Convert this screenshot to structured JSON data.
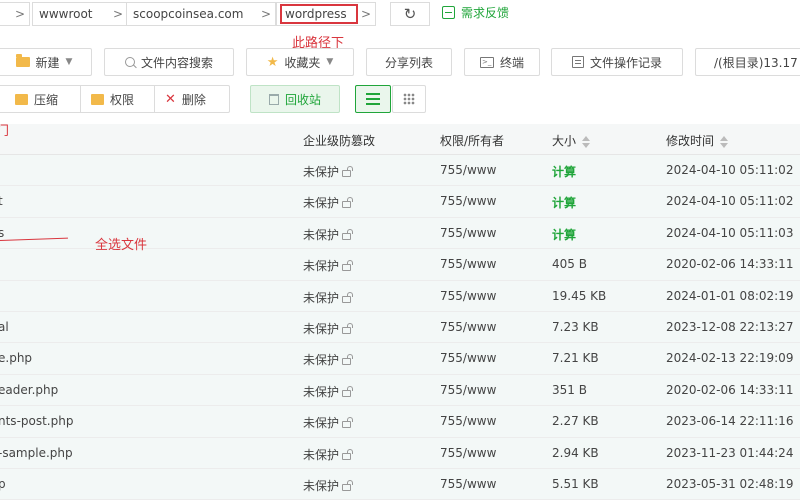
{
  "breadcrumb": {
    "items": [
      "wwwroot",
      "scoopcoinsea.com",
      "wordpress"
    ],
    "separator": ">",
    "feedback_label": "需求反馈"
  },
  "annotations": {
    "path_note": "此路径下",
    "select_all_note": "全选文件",
    "left_cut_note": "门"
  },
  "toolbar": {
    "new_label": "新建",
    "content_search_label": "文件内容搜索",
    "favorites_label": "收藏夹",
    "share_list_label": "分享列表",
    "terminal_label": "终端",
    "file_log_label": "文件操作记录",
    "root_path_label": "/(根目录)13.17",
    "compress_label": "压缩",
    "permission_label": "权限",
    "delete_label": "删除",
    "recycle_label": "回收站"
  },
  "table": {
    "headers": {
      "protection": "企业级防篡改",
      "perm_owner": "权限/所有者",
      "size": "大小",
      "mtime": "修改时间"
    },
    "rows": [
      {
        "name": "",
        "protection": "未保护",
        "perm": "755/www",
        "size": "计算",
        "mtime": "2024-04-10 05:11:02"
      },
      {
        "name": "t",
        "protection": "未保护",
        "perm": "755/www",
        "size": "计算",
        "mtime": "2024-04-10 05:11:02"
      },
      {
        "name": "s",
        "protection": "未保护",
        "perm": "755/www",
        "size": "计算",
        "mtime": "2024-04-10 05:11:03"
      },
      {
        "name": "",
        "protection": "未保护",
        "perm": "755/www",
        "size": "405 B",
        "mtime": "2020-02-06 14:33:11"
      },
      {
        "name": "",
        "protection": "未保护",
        "perm": "755/www",
        "size": "19.45 KB",
        "mtime": "2024-01-01 08:02:19"
      },
      {
        "name": "al",
        "protection": "未保护",
        "perm": "755/www",
        "size": "7.23 KB",
        "mtime": "2023-12-08 22:13:27"
      },
      {
        "name": "e.php",
        "protection": "未保护",
        "perm": "755/www",
        "size": "7.21 KB",
        "mtime": "2024-02-13 22:19:09"
      },
      {
        "name": "eader.php",
        "protection": "未保护",
        "perm": "755/www",
        "size": "351 B",
        "mtime": "2020-02-06 14:33:11"
      },
      {
        "name": "nts-post.php",
        "protection": "未保护",
        "perm": "755/www",
        "size": "2.27 KB",
        "mtime": "2023-06-14 22:11:16"
      },
      {
        "name": "-sample.php",
        "protection": "未保护",
        "perm": "755/www",
        "size": "2.94 KB",
        "mtime": "2023-11-23 01:44:24"
      },
      {
        "name": "p",
        "protection": "未保护",
        "perm": "755/www",
        "size": "5.51 KB",
        "mtime": "2023-05-31 02:48:19"
      }
    ]
  },
  "colors": {
    "accent_green": "#20a53a",
    "annotation_red": "#d9363e"
  }
}
